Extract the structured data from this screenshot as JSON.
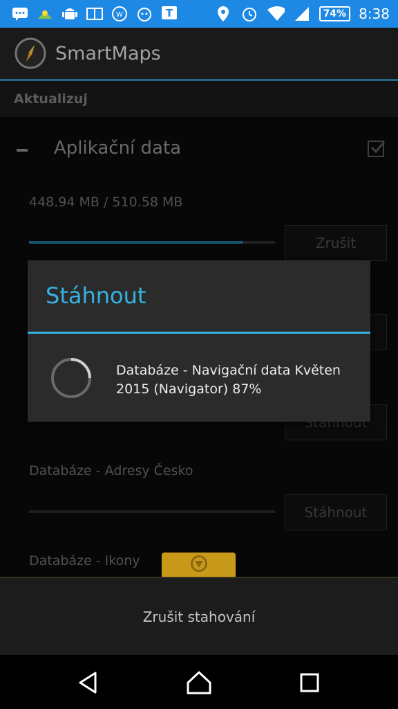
{
  "status_bar": {
    "battery": "74%",
    "time": "8:38",
    "icons": [
      "messages-icon",
      "weather-icon",
      "android-icon",
      "news-icon",
      "sync-icon",
      "notification-icon",
      "t-app-icon",
      "location-icon",
      "alarm-icon",
      "wifi-icon",
      "signal-icon",
      "battery-icon"
    ]
  },
  "app_bar": {
    "title": "SmartMaps",
    "logo_icon": "compass-icon"
  },
  "section": {
    "title": "Aktualizuj"
  },
  "group": {
    "title": "Aplikační data",
    "checked": true
  },
  "items": [
    {
      "label": "448.94 MB / 510.58 MB",
      "progress": 0.87,
      "button": "Zrušit"
    },
    {
      "label": "",
      "progress": 0,
      "button": "Stáhnout"
    },
    {
      "label": "",
      "progress": 0,
      "button": "Stáhnout"
    },
    {
      "label": "Databáze - Adresy Česko",
      "progress": 0,
      "button": "Stáhnout"
    },
    {
      "label": "Databáze - Ikony"
    }
  ],
  "dialog": {
    "title": "Stáhnout",
    "message": "Databáze - Navigační data Květen 2015 (Navigator) 87%"
  },
  "bottom": {
    "cancel_label": "Zrušit stahování"
  },
  "colors": {
    "accent": "#35b2df",
    "status_bar": "#1e88e5",
    "floater": "#c99a1a"
  }
}
